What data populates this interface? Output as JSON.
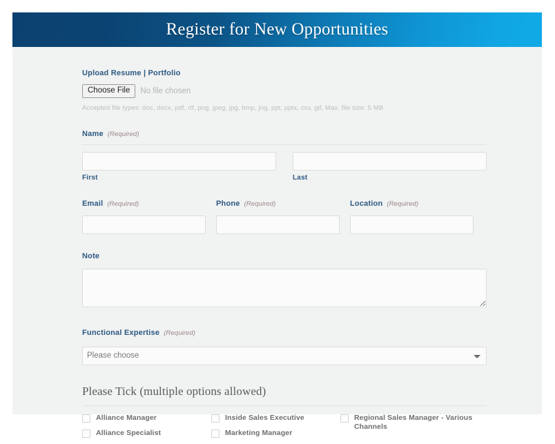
{
  "header": {
    "title": "Register for New Opportunities",
    "gradient_from": "#0b4170",
    "gradient_to": "#11a9e6"
  },
  "theme": {
    "label_color": "#2c5982",
    "required_color": "#9a8585",
    "panel_bg": "#f1f2f2"
  },
  "upload": {
    "label": "Upload Resume | Portfolio",
    "button_label": "Choose File",
    "status_text": "No file chosen",
    "accepted_note": "Accepted file types: doc, docx, pdf, rtf, png, jpeg, jpg, bmp, jng, ppt, pptx, csv, gif, Max. file size: 5 MB."
  },
  "name": {
    "label": "Name",
    "required": "(Required)",
    "first_value": "",
    "first_sub_label": "First",
    "last_value": "",
    "last_sub_label": "Last"
  },
  "contact": {
    "email": {
      "label": "Email",
      "required": "(Required)",
      "value": ""
    },
    "phone": {
      "label": "Phone",
      "required": "(Required)",
      "value": ""
    },
    "location": {
      "label": "Location",
      "required": "(Required)",
      "value": ""
    }
  },
  "note": {
    "label": "Note",
    "value": ""
  },
  "expertise": {
    "label": "Functional Expertise",
    "required": "(Required)",
    "selected": "Please choose"
  },
  "tick_section": {
    "heading": "Please Tick (multiple options allowed)",
    "columns": [
      {
        "items": [
          {
            "label": "Alliance Manager",
            "checked": false
          },
          {
            "label": "Alliance Specialist",
            "checked": false
          }
        ]
      },
      {
        "items": [
          {
            "label": "Inside Sales Executive",
            "checked": false
          },
          {
            "label": "Marketing Manager",
            "checked": false
          }
        ]
      },
      {
        "items": [
          {
            "label": "Regional Sales Manager - Various Channels",
            "checked": false
          }
        ]
      }
    ]
  }
}
